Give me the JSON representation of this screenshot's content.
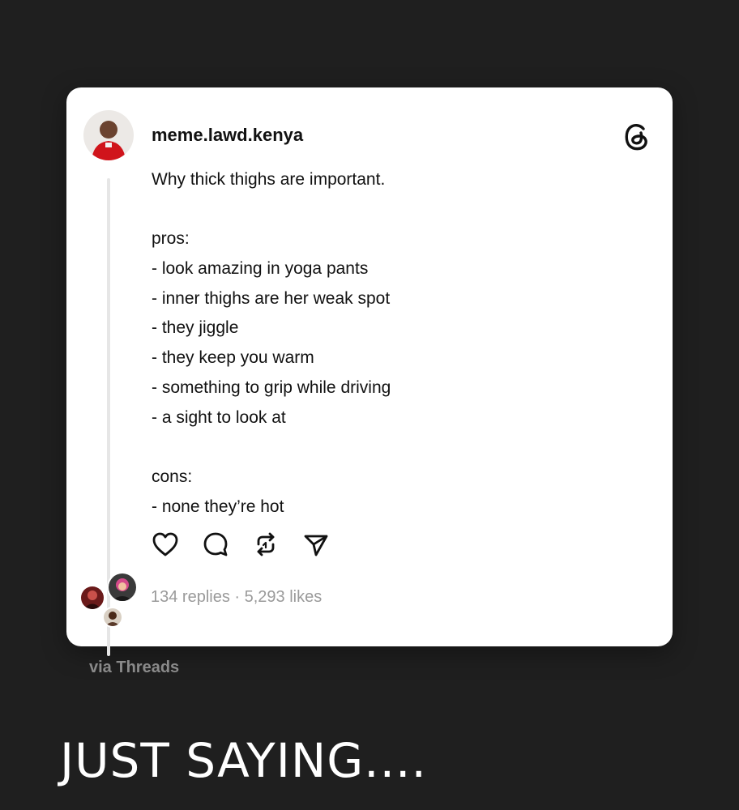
{
  "post": {
    "username": "meme.lawd.kenya",
    "lines": [
      "Why thick thighs are important.",
      "",
      "pros:",
      "- look amazing in yoga pants",
      "- inner thighs are her weak spot",
      "- they jiggle",
      "- they keep you warm",
      "- something to grip while driving",
      "- a sight to look at",
      "",
      "cons:",
      "- none they’re hot"
    ],
    "stats": "134 replies · 5,293 likes",
    "icons": [
      "threads-logo-icon",
      "heart-icon",
      "comment-icon",
      "repost-icon",
      "share-icon"
    ]
  },
  "footer": {
    "via": "via Threads",
    "caption": "JUST SAYING...."
  },
  "colors": {
    "background": "#1f1f1f",
    "card": "#ffffff",
    "text": "#111111",
    "muted": "#9a9a9a"
  }
}
